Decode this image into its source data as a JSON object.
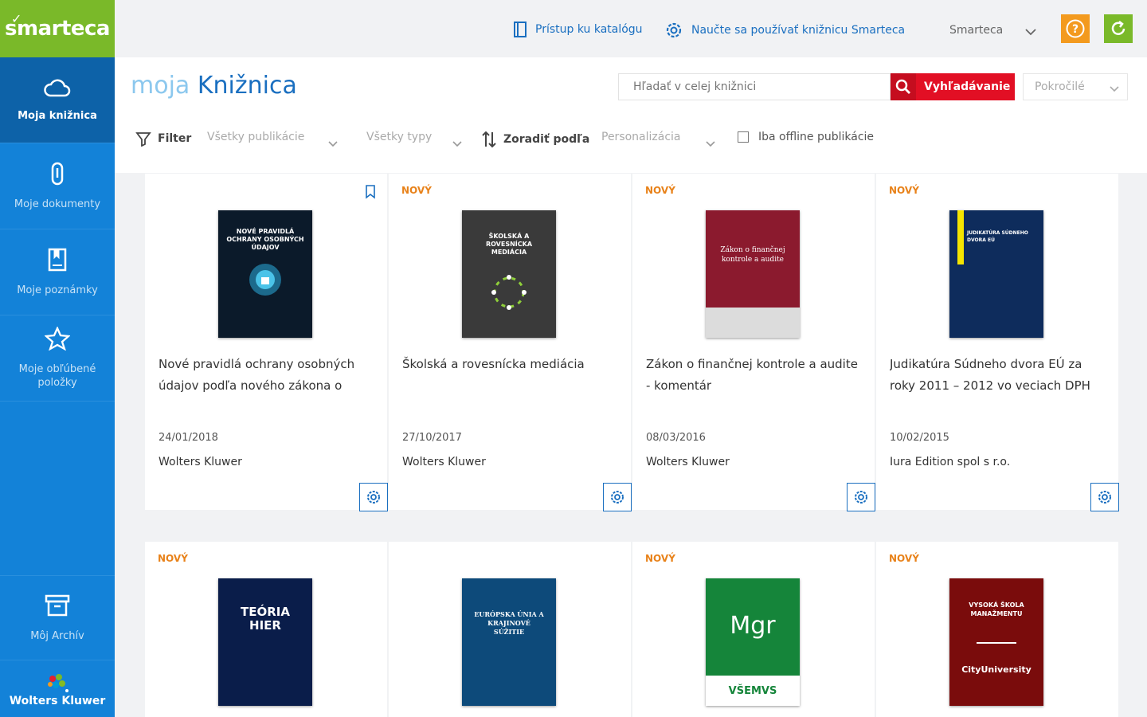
{
  "logo": {
    "text": "smarteca"
  },
  "sidebar": {
    "items": [
      {
        "label": "Moja knižnica",
        "icon": "cloud-icon",
        "active": true
      },
      {
        "label": "Moje dokumenty",
        "icon": "paperclip-icon",
        "active": false
      },
      {
        "label": "Moje poznámky",
        "icon": "note-icon",
        "active": false
      },
      {
        "label": "Moje obľúbené položky",
        "icon": "star-icon",
        "active": false
      }
    ],
    "archive": {
      "label": "Môj Archív",
      "icon": "archive-icon"
    },
    "brand": {
      "label": "Wolters Kluwer"
    }
  },
  "topbar": {
    "catalog_link": "Prístup ku katalógu",
    "learn_link": "Naučte sa používať knižnicu Smarteca",
    "user_name": "Smarteca",
    "help_label": "?",
    "colors": {
      "help": "#f39a1e",
      "refresh": "#7ab929"
    }
  },
  "header": {
    "title_prefix": "moja",
    "title_main": "Knižnica",
    "search_placeholder": "Hľadať v celej knižnici",
    "search_button": "Vyhľadávanie",
    "advanced_label": "Pokročilé"
  },
  "filters": {
    "filter_label": "Filter",
    "publications": "Všetky publikácie",
    "types": "Všetky typy",
    "sort_label": "Zoradiť podľa",
    "sort_value": "Personalizácia",
    "offline_label": "Iba offline publikácie"
  },
  "badge_new": "NOVÝ",
  "books": [
    {
      "title": "Nové pravidlá ochrany osobných údajov podľa nového zákona o",
      "date": "24/01/2018",
      "publisher": "Wolters Kluwer",
      "is_new": false,
      "cover_text": "NOVÉ PRAVIDLÁ OCHRANY OSOBNÝCH ÚDAJOV",
      "cover_color": "#0b1a2a"
    },
    {
      "title": "Školská a rovesnícka mediácia",
      "date": "27/10/2017",
      "publisher": "Wolters Kluwer",
      "is_new": true,
      "cover_text": "ŠKOLSKÁ A ROVESNÍCKA MEDIÁCIA",
      "cover_color": "#3a3a3a"
    },
    {
      "title": "Zákon o finančnej kontrole a audite - komentár",
      "date": "08/03/2016",
      "publisher": "Wolters Kluwer",
      "is_new": true,
      "cover_text": "Zákon o finančnej kontrole a audite",
      "cover_color": "#8b1a2e"
    },
    {
      "title": "Judikatúra Súdneho dvora EÚ za roky 2011 – 2012 vo veciach DPH",
      "date": "10/02/2015",
      "publisher": "Iura Edition spol s r.o.",
      "is_new": true,
      "cover_text": "JUDIKATÚRA SÚDNEHO DVORA EÚ",
      "cover_color": "#0e2c5c"
    },
    {
      "title": "",
      "date": "",
      "publisher": "",
      "is_new": true,
      "cover_text": "TEÓRIA HIER",
      "cover_color": "#0a1d4a"
    },
    {
      "title": "",
      "date": "",
      "publisher": "",
      "is_new": false,
      "cover_text": "EURÓPSKA ÚNIA A KRAJINOVÉ SÚŽITIE",
      "cover_color": "#0d4a7a"
    },
    {
      "title": "",
      "date": "",
      "publisher": "",
      "is_new": true,
      "cover_text": "Mgr",
      "cover_sub": "VŠEMVS",
      "cover_color": "#15853a"
    },
    {
      "title": "",
      "date": "",
      "publisher": "",
      "is_new": true,
      "cover_text": "VYSOKÁ ŠKOLA MANAŽMENTU",
      "cover_sub": "CityUniversity",
      "cover_color": "#7a0c0c"
    }
  ]
}
